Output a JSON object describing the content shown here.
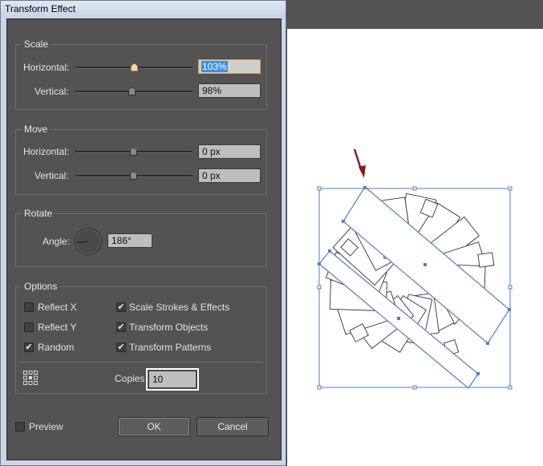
{
  "dialog": {
    "title": "Transform Effect",
    "scale": {
      "label": "Scale",
      "horizontal_label": "Horizontal:",
      "horizontal_value": "103%",
      "vertical_label": "Vertical:",
      "vertical_value": "98%"
    },
    "move": {
      "label": "Move",
      "horizontal_label": "Horizontal:",
      "horizontal_value": "0 px",
      "vertical_label": "Vertical:",
      "vertical_value": "0 px"
    },
    "rotate": {
      "label": "Rotate",
      "angle_label": "Angle:",
      "angle_value": "186°"
    },
    "options": {
      "label": "Options",
      "reflect_x": {
        "label": "Reflect X",
        "checked": false
      },
      "reflect_y": {
        "label": "Reflect Y",
        "checked": false
      },
      "random": {
        "label": "Random",
        "checked": true
      },
      "scale_strokes": {
        "label": "Scale Strokes & Effects",
        "checked": true
      },
      "transform_objects": {
        "label": "Transform Objects",
        "checked": true
      },
      "transform_patterns": {
        "label": "Transform Patterns",
        "checked": true
      },
      "copies_label": "Copies",
      "copies_value": "10"
    },
    "preview": {
      "label": "Preview",
      "checked": false
    },
    "ok_label": "OK",
    "cancel_label": "Cancel"
  },
  "colors": {
    "dialog_bg": "#535353",
    "selection_blue": "#4f7fc8",
    "arrow": "#8a1a1a",
    "field_highlight": "#3b8fe0",
    "active_border": "#e8a040"
  },
  "icons": {
    "checkmark": "✔",
    "reference_point": "reference-point-grid-icon",
    "angle_dial": "angle-dial-icon"
  }
}
